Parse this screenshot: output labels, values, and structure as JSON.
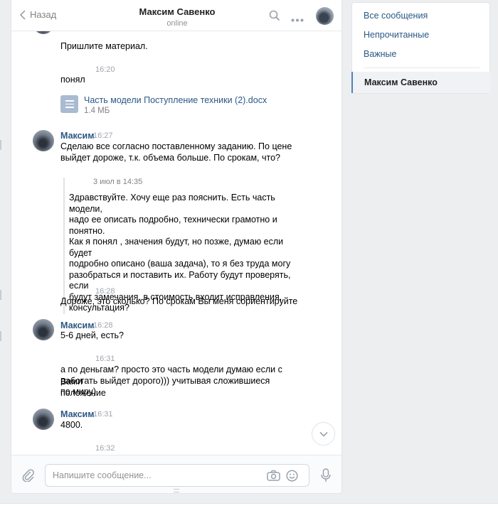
{
  "header": {
    "back_label": "Назад",
    "peer_name": "Максим Савенко",
    "peer_status": "online"
  },
  "messages": {
    "m1_text": "Пришлите материал.",
    "m2_time": "16:20",
    "m2_text": "понял",
    "doc_name": "Часть модели Поступление техники (2).docx",
    "doc_size": "1.4 МБ",
    "m3_author": "Максим",
    "m3_time": "16:27",
    "m3_line1": "Сделаю все согласно поставленному заданию. По цене",
    "m3_line2": "выйдет дороже, т.к. объема больше. По срокам, что?",
    "quote_date": "3 июл в 14:35",
    "quote_text": "Здравствуйте. Хочу еще раз пояснить. Есть часть модели,\nнадо ее описать подробно, технически грамотно и понятно.\nКак я понял , значения будут, но позже, думаю если будет\nподробно описано (ваша задача), то я без труда могу\nразобраться и поставить их. Работу будут проверять, если\nбудут замечания, в стоимость входит исправления,\nконсультация?",
    "m4_time": "16:28",
    "m4_text": "Дороже, это сколько? По срокам Вы меня сориентируйте",
    "m5_author": "Максим",
    "m5_time": "16:28",
    "m5_text": "5-6 дней, есть?",
    "m6_time": "16:31",
    "m6_line1": "а по деньгам? просто это часть модели думаю если с Вами",
    "m6_line2": "работать выйдет дорого))) учитывая сложившиеся положение",
    "m6_line3": "по миру)",
    "m7_author": "Максим",
    "m7_time": "16:31",
    "m7_text": "4800.",
    "m8_time": "16:32"
  },
  "composer": {
    "placeholder": "Напишите сообщение..."
  },
  "menu": {
    "all": "Все сообщения",
    "unread": "Непрочитанные",
    "important": "Важные",
    "active": "Максим Савенко"
  },
  "colors": {
    "link": "#2a5885",
    "accent": "#5181b8",
    "background": "#edeef0"
  }
}
